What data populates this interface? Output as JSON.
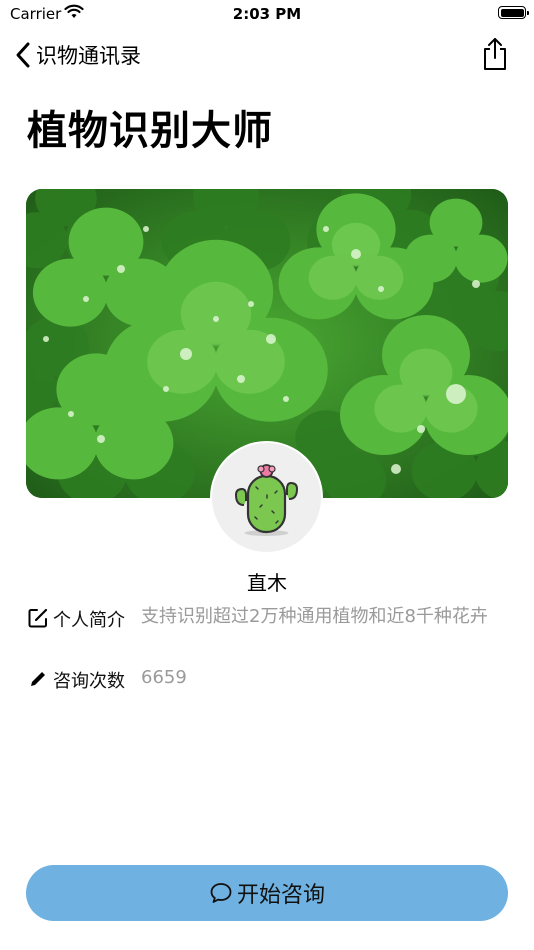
{
  "status_bar": {
    "carrier": "Carrier",
    "time": "2:03 PM"
  },
  "nav": {
    "back_label": "识物通讯录"
  },
  "page_title": "植物识别大师",
  "profile": {
    "name": "直木"
  },
  "info": {
    "intro_label": "个人简介",
    "intro_value": "支持识别超过2万种通用植物和近8千种花卉",
    "count_label": "咨询次数",
    "count_value": "6659"
  },
  "action": {
    "consult_label": "开始咨询"
  },
  "icons": {
    "back": "chevron-left-icon",
    "share": "share-icon",
    "edit": "edit-square-icon",
    "pencil": "pencil-icon",
    "chat": "chat-bubble-icon",
    "avatar": "cactus-icon"
  },
  "colors": {
    "accent": "#6fb1e0",
    "muted_text": "#9a9a9a"
  }
}
